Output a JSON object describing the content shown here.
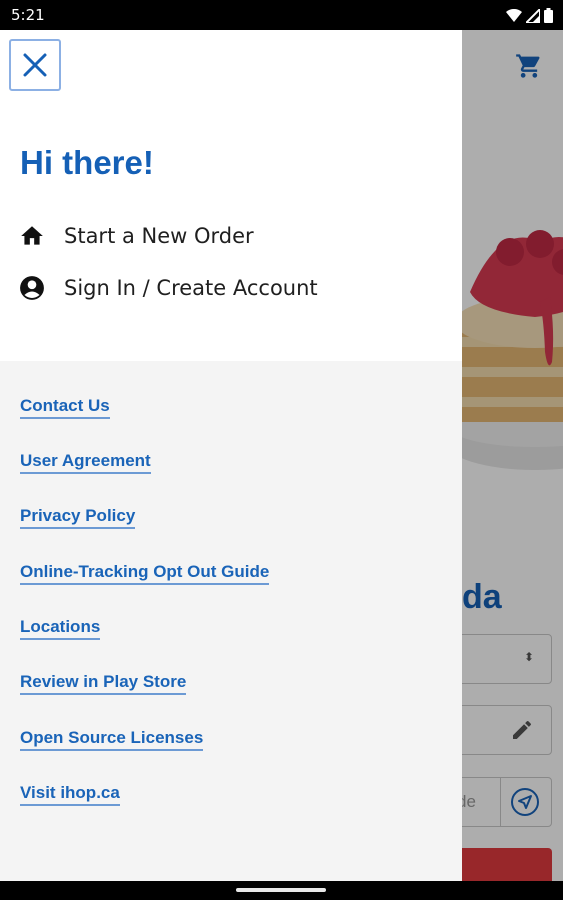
{
  "status_bar": {
    "time": "5:21",
    "icons": [
      "wifi-icon",
      "signal-icon",
      "battery-icon"
    ]
  },
  "drawer": {
    "greeting": "Hi there!",
    "menu": [
      {
        "label": "Start a New Order",
        "icon": "home-icon"
      },
      {
        "label": "Sign In / Create Account",
        "icon": "account-circle-icon"
      }
    ],
    "links": [
      "Contact Us",
      "User Agreement",
      "Privacy Policy",
      "Online-Tracking Opt Out Guide",
      "Locations",
      "Review in Play Store",
      "Open Source Licenses",
      "Visit ihop.ca"
    ]
  },
  "background": {
    "heading_fragment": "da",
    "field_fragment": "de",
    "icons": [
      "cart-icon",
      "stepper-icon",
      "pencil-icon",
      "location-arrow-icon"
    ]
  },
  "colors": {
    "brand_blue": "#1560b6",
    "link_blue": "#1a64b8",
    "accent_red": "#e03a3e"
  }
}
